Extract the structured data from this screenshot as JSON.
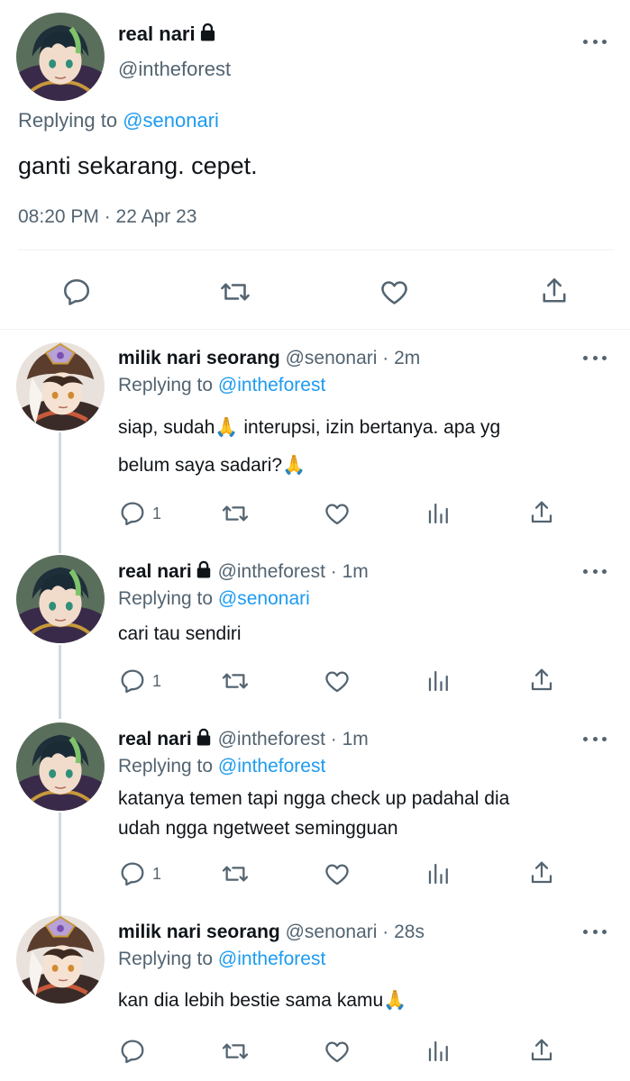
{
  "main_tweet": {
    "display_name": "real nari",
    "handle": "@intheforest",
    "replying_label": "Replying to",
    "replying_handle": "@senonari",
    "text": "ganti sekarang. cepet.",
    "timestamp": "08:20 PM · 22 Apr 23",
    "actions": [
      "reply-icon",
      "retweet-icon",
      "like-icon",
      "share-icon"
    ]
  },
  "replies": [
    {
      "display_name": "milik nari seorang",
      "handle": "@senonari",
      "time": "· 2m",
      "replying_label": "Replying to",
      "replying_handle": "@intheforest",
      "line1": "siap, sudah🙏 interupsi, izin bertanya. apa yg",
      "line2": "belum saya sadari?🙏",
      "reply_count": "1"
    },
    {
      "display_name": "real nari",
      "handle": "@intheforest",
      "time": "· 1m",
      "replying_label": "Replying to",
      "replying_handle": "@senonari",
      "line1": "cari tau sendiri",
      "reply_count": "1"
    },
    {
      "display_name": "real nari",
      "handle": "@intheforest",
      "time": "· 1m",
      "replying_label": "Replying to",
      "replying_handle": "@intheforest",
      "line1": "katanya temen tapi ngga check up padahal dia",
      "line2": "udah ngga ngetweet semingguan",
      "reply_count": "1"
    },
    {
      "display_name": "milik nari seorang",
      "handle": "@senonari",
      "time": "· 28s",
      "replying_label": "Replying to",
      "replying_handle": "@intheforest",
      "line1": "kan dia lebih bestie sama kamu🙏",
      "reply_count": ""
    }
  ],
  "colors": {
    "text": "#0f1419",
    "secondary": "#536471",
    "link": "#1d9bf0",
    "divider": "#eff3f4",
    "thread_line": "#cfd9de"
  }
}
